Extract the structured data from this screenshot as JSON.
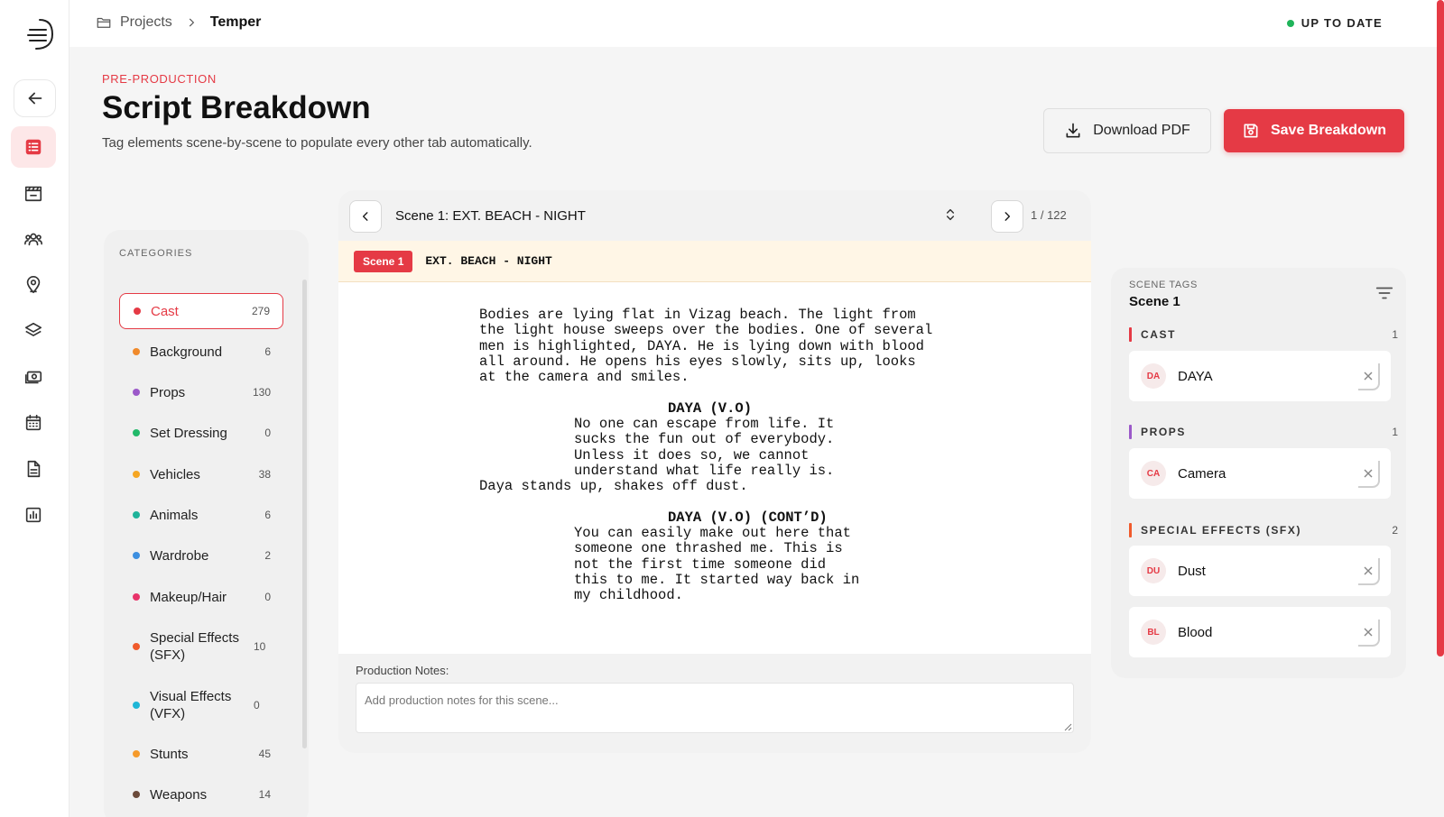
{
  "breadcrumb": {
    "root": "Projects",
    "current": "Temper"
  },
  "status": "UP TO DATE",
  "header": {
    "eyebrow": "PRE-PRODUCTION",
    "title": "Script Breakdown",
    "subtitle": "Tag elements scene-by-scene to populate every other tab automatically.",
    "download_label": "Download PDF",
    "save_label": "Save Breakdown"
  },
  "categories": {
    "heading": "CATEGORIES",
    "items": [
      {
        "label": "Cast",
        "count": "279",
        "color": "#e53a45"
      },
      {
        "label": "Background",
        "count": "6",
        "color": "#f08a2b"
      },
      {
        "label": "Props",
        "count": "130",
        "color": "#9b59c9"
      },
      {
        "label": "Set Dressing",
        "count": "0",
        "color": "#22b96a"
      },
      {
        "label": "Vehicles",
        "count": "38",
        "color": "#f5a623"
      },
      {
        "label": "Animals",
        "count": "6",
        "color": "#1fb39a"
      },
      {
        "label": "Wardrobe",
        "count": "2",
        "color": "#3d8fe0"
      },
      {
        "label": "Makeup/Hair",
        "count": "0",
        "color": "#e8336a"
      },
      {
        "label": "Special Effects (SFX)",
        "count": "10",
        "color": "#f05a2b"
      },
      {
        "label": "Visual Effects (VFX)",
        "count": "0",
        "color": "#1fb6d6"
      },
      {
        "label": "Stunts",
        "count": "45",
        "color": "#f59a2b"
      },
      {
        "label": "Weapons",
        "count": "14",
        "color": "#6b4a3a"
      }
    ]
  },
  "scene": {
    "selector": "Scene 1: EXT. BEACH - NIGHT",
    "page_count": "1 / 122",
    "badge": "Scene 1",
    "slug": "EXT. BEACH - NIGHT",
    "action1": "Bodies are lying flat in Vizag beach. The light from\nthe light house sweeps over the bodies. One of several\nmen is highlighted, DAYA. He is lying down with blood\nall around. He opens his eyes slowly, sits up, looks\nat the camera and smiles.",
    "character1": "DAYA (V.O)",
    "dialogue1": "No one can escape from life. It\nsucks the fun out of everybody.\nUnless it does so, we cannot\nunderstand what life really is.",
    "action2": "Daya stands up, shakes off dust.",
    "character2": "DAYA (V.O) (CONT’D)",
    "dialogue2": "You can easily make out here that\nsomeone one thrashed me. This is\nnot the first time someone did\nthis to me. It started way back in\nmy childhood.",
    "notes_label": "Production Notes:",
    "notes_placeholder": "Add production notes for this scene..."
  },
  "tags": {
    "heading_small": "SCENE TAGS",
    "heading_big": "Scene 1",
    "groups": [
      {
        "title": "CAST",
        "count": "1",
        "color": "#e53a45",
        "items": [
          {
            "abbr": "DA",
            "name": "DAYA"
          }
        ]
      },
      {
        "title": "PROPS",
        "count": "1",
        "color": "#9b59c9",
        "items": [
          {
            "abbr": "CA",
            "name": "Camera"
          }
        ]
      },
      {
        "title": "SPECIAL EFFECTS (SFX)",
        "count": "2",
        "color": "#f05a2b",
        "items": [
          {
            "abbr": "DU",
            "name": "Dust"
          },
          {
            "abbr": "BL",
            "name": "Blood"
          }
        ]
      }
    ]
  }
}
